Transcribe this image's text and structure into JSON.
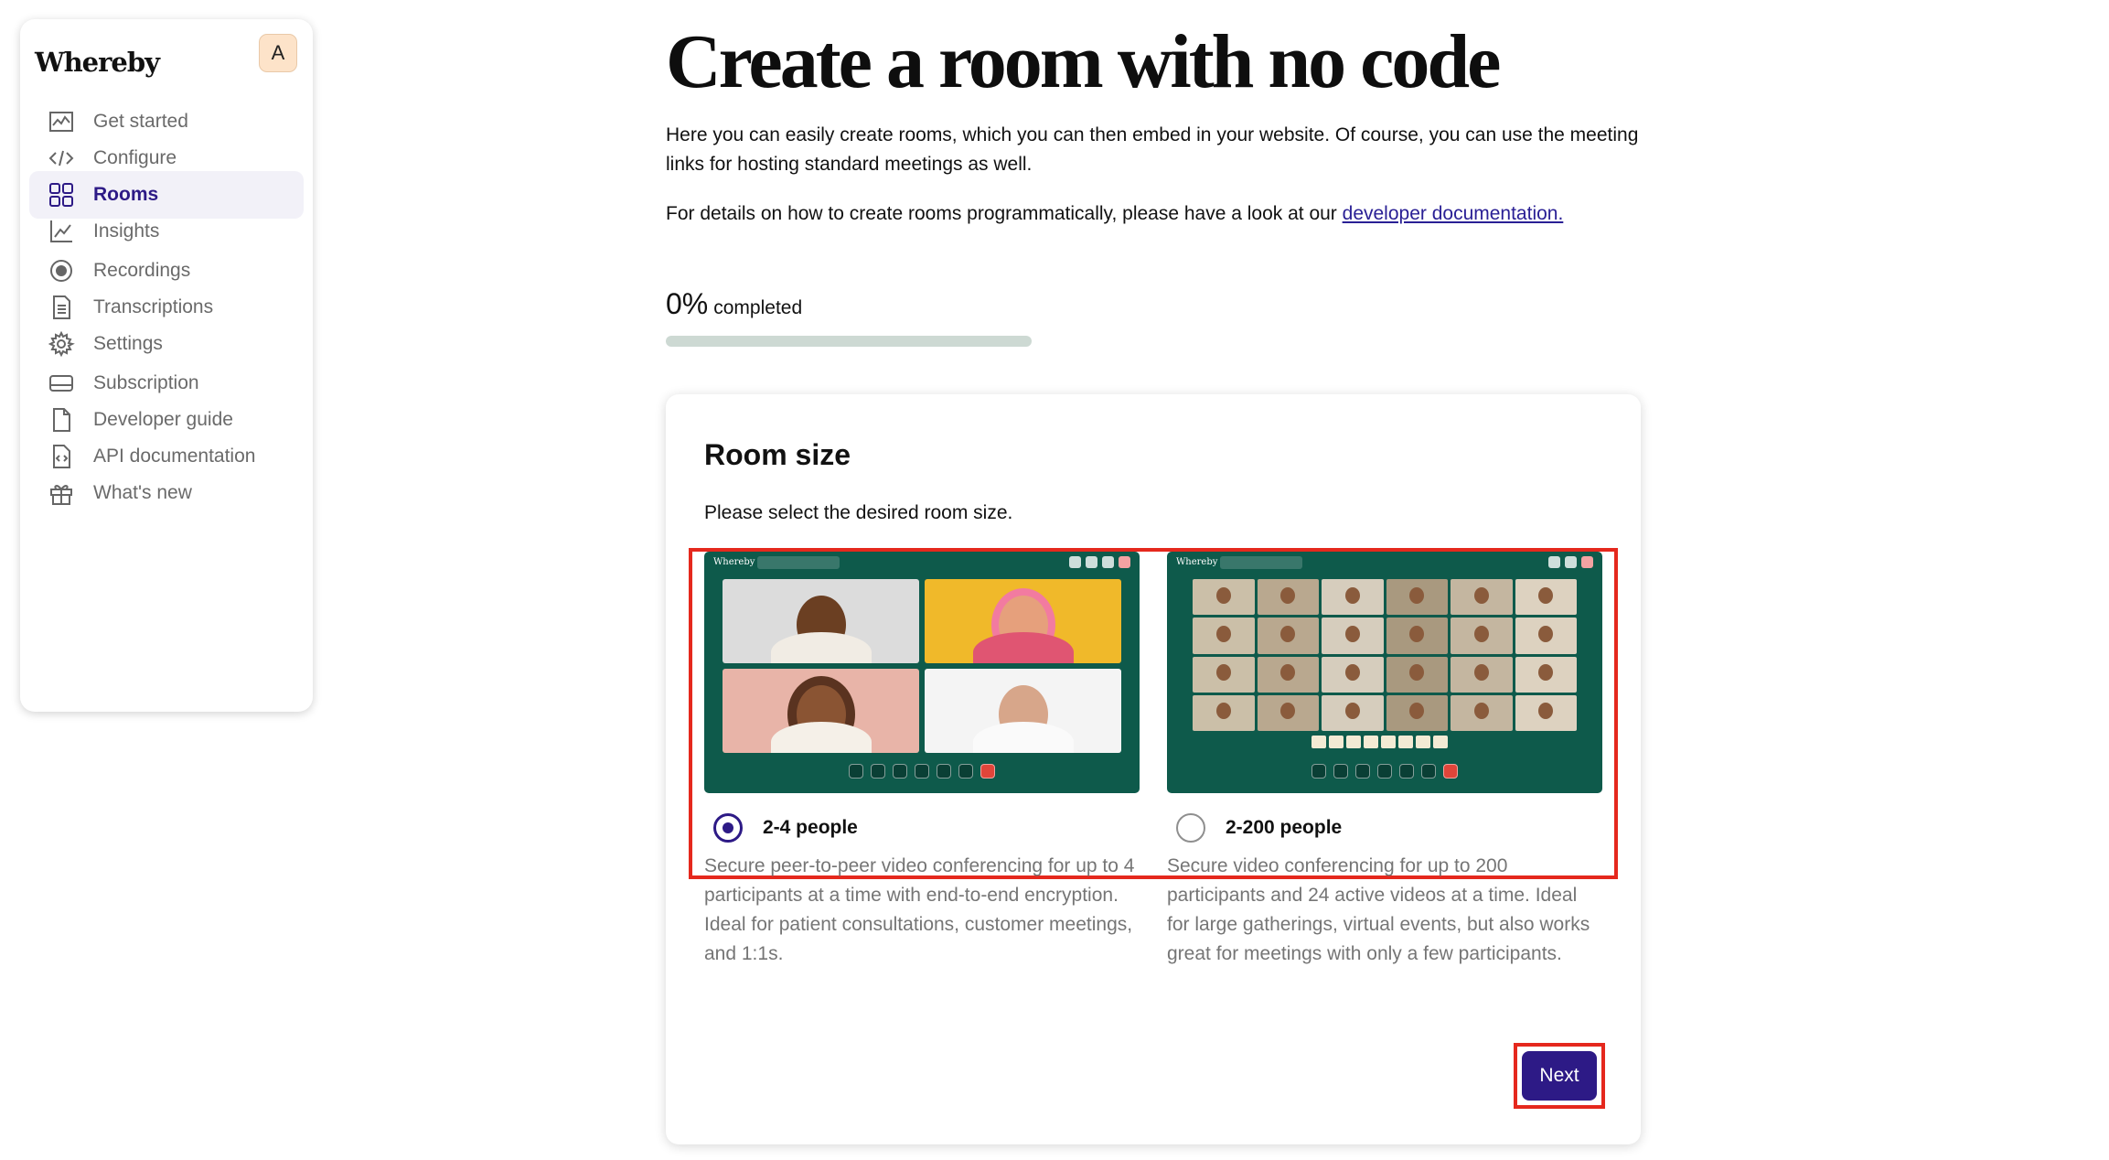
{
  "sidebar": {
    "brand": "Whereby",
    "avatar_initial": "A",
    "items": [
      {
        "label": "Get started",
        "icon": "chart-icon"
      },
      {
        "label": "Configure",
        "icon": "code-icon"
      },
      {
        "label": "Rooms",
        "icon": "grid-icon",
        "active": true
      },
      {
        "label": "Insights",
        "icon": "line-chart-icon"
      },
      {
        "label": "Recordings",
        "icon": "record-icon"
      },
      {
        "label": "Transcriptions",
        "icon": "document-icon"
      },
      {
        "label": "Settings",
        "icon": "gear-icon"
      },
      {
        "label": "Subscription",
        "icon": "card-icon"
      },
      {
        "label": "Developer guide",
        "icon": "file-icon"
      },
      {
        "label": "API documentation",
        "icon": "api-doc-icon"
      },
      {
        "label": "What's new",
        "icon": "gift-icon"
      }
    ]
  },
  "main": {
    "title": "Create a room with no code",
    "intro": "Here you can easily create rooms, which you can then embed in your website. Of course, you can use the meeting links for hosting standard meetings as well.",
    "intro2_prefix": "For details on how to create rooms programmatically, please have a look at our ",
    "intro2_link": "developer documentation.",
    "progress": {
      "percent_label": "0%",
      "label": "completed",
      "value": 0
    }
  },
  "card": {
    "title": "Room size",
    "subtitle": "Please select the desired room size.",
    "options": [
      {
        "label": "2-4 people",
        "selected": true,
        "preview_brand": "Whereby",
        "description": "Secure peer-to-peer video conferencing for up to 4 participants at a time with end-to-end encryption. Ideal for patient consultations, customer meetings, and 1:1s."
      },
      {
        "label": "2-200 people",
        "selected": false,
        "preview_brand": "Whereby",
        "description": "Secure video conferencing for up to 200 participants and 24 active videos at a time. Ideal for large gatherings, virtual events, but also works great for meetings with only a few participants."
      }
    ],
    "next_label": "Next"
  },
  "colors": {
    "accent": "#2d1a86",
    "highlight": "#e5281d",
    "preview_bg": "#0e5a4b",
    "progress_track": "#cdd9d3"
  }
}
